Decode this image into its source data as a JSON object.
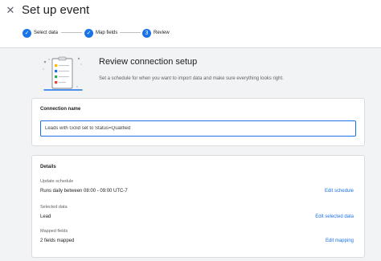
{
  "header": {
    "title": "Set up event",
    "close_icon": "close-icon"
  },
  "stepper": {
    "steps": [
      {
        "label": "Select data",
        "state": "completed",
        "icon": "check-icon"
      },
      {
        "label": "Map fields",
        "state": "completed",
        "icon": "check-icon"
      },
      {
        "label": "Review",
        "state": "current",
        "number": "3"
      }
    ]
  },
  "hero": {
    "title": "Review connection setup",
    "subtitle": "Set a schedule for when you want to import data and make sure everything looks right.",
    "illustration": "checklist-clipboard-illustration"
  },
  "connection": {
    "label": "Connection name",
    "value": "Leads with Gclid set to Status=Qualified"
  },
  "details": {
    "title": "Details",
    "rows": [
      {
        "label": "Update schedule",
        "value": "Runs daily between 08:00 - 09:00 UTC-7",
        "action": "Edit schedule"
      },
      {
        "label": "Selected data",
        "value": "Lead",
        "action": "Edit selected data"
      },
      {
        "label": "Mapped fields",
        "value": "2 fields mapped",
        "action": "Edit mapping"
      }
    ]
  },
  "colors": {
    "accent": "#1a73e8",
    "background": "#f1f3f4",
    "text": "#202124",
    "secondary_text": "#5f6368"
  }
}
